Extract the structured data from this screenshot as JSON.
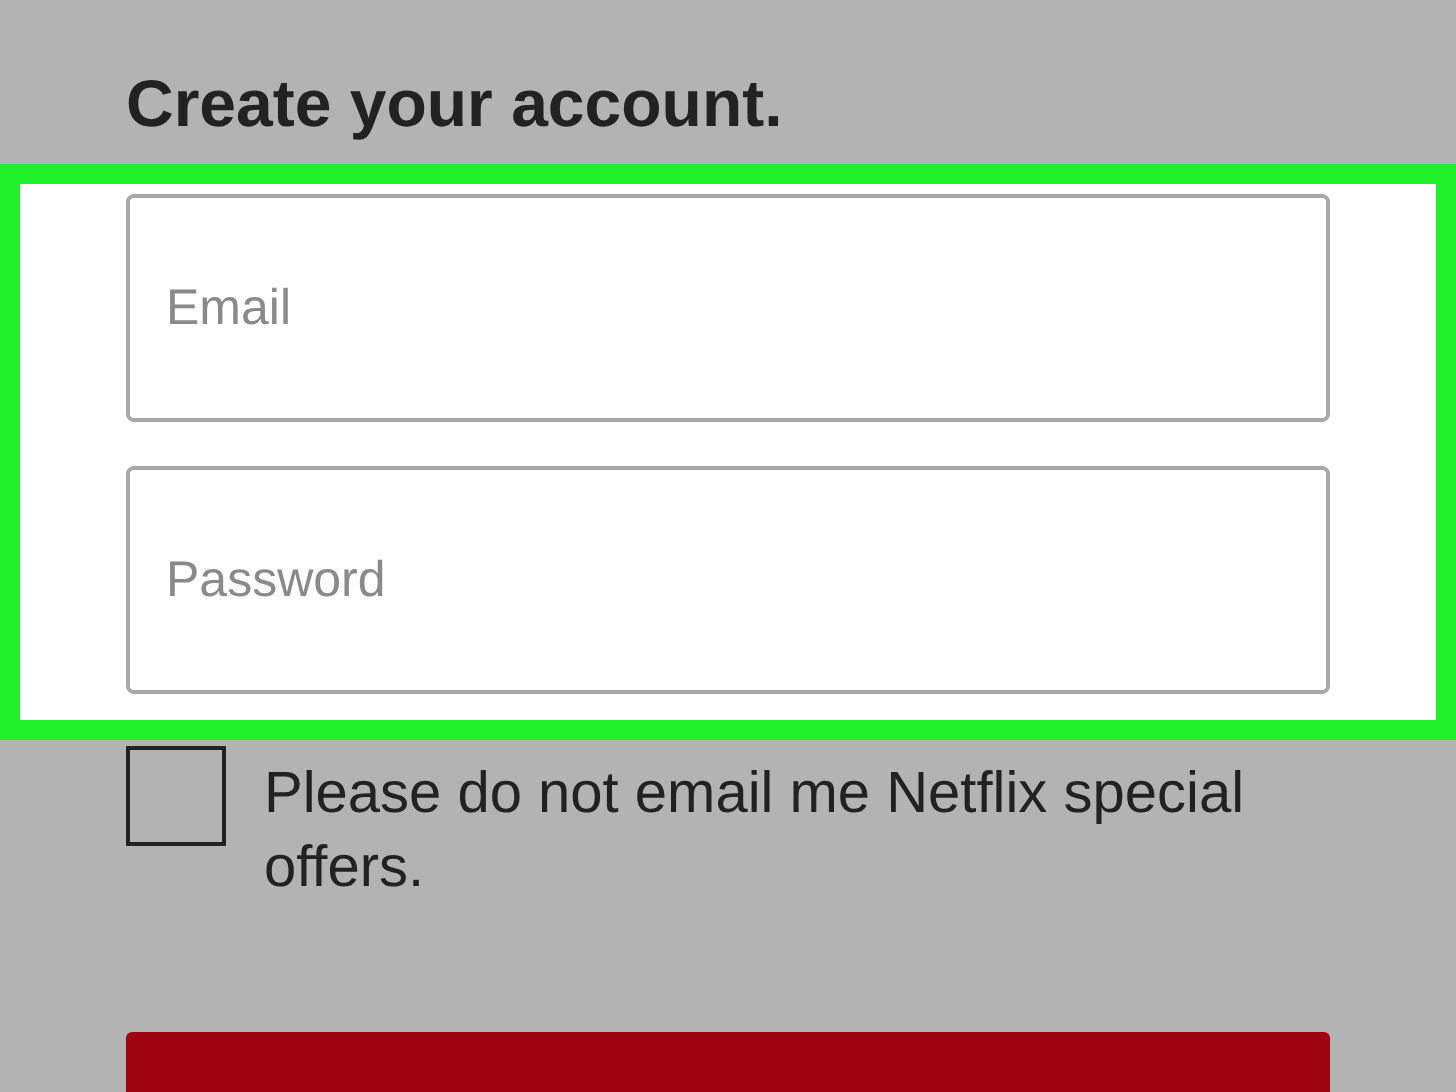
{
  "heading": "Create your account.",
  "fields": [
    {
      "placeholder": "Email"
    },
    {
      "placeholder": "Password"
    }
  ],
  "opt_out": {
    "label": "Please do not email me Netflix special offers.",
    "checked": false
  }
}
